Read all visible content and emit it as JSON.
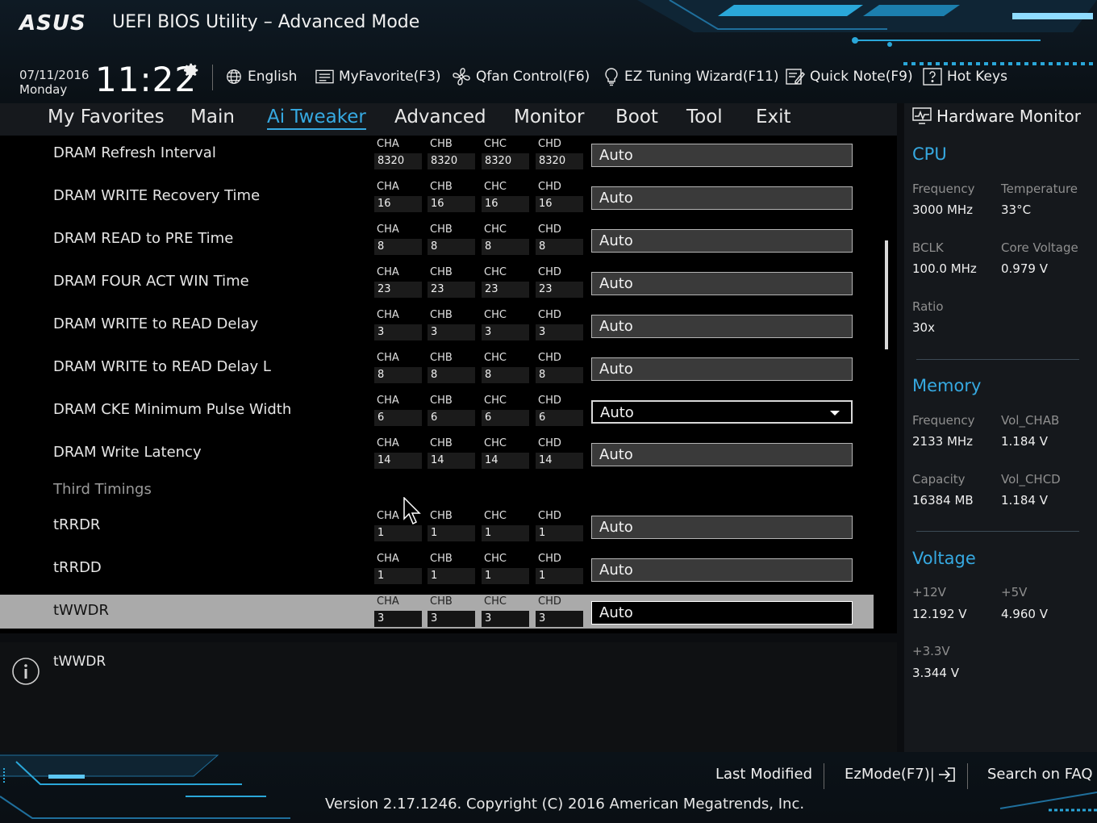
{
  "header": {
    "logo": "ASUS",
    "title": "UEFI BIOS Utility – Advanced Mode",
    "date": "07/11/2016",
    "day": "Monday",
    "time": "11:22",
    "toolbar": [
      {
        "label": "English",
        "icon": "globe-icon"
      },
      {
        "label": "MyFavorite(F3)",
        "icon": "favorite-list-icon"
      },
      {
        "label": "Qfan Control(F6)",
        "icon": "fan-icon"
      },
      {
        "label": "EZ Tuning Wizard(F11)",
        "icon": "lightbulb-icon"
      },
      {
        "label": "Quick Note(F9)",
        "icon": "note-icon"
      },
      {
        "label": "Hot Keys",
        "icon": "help-key-icon"
      }
    ]
  },
  "nav": {
    "tabs": [
      "My Favorites",
      "Main",
      "Ai Tweaker",
      "Advanced",
      "Monitor",
      "Boot",
      "Tool",
      "Exit"
    ],
    "active": "Ai Tweaker"
  },
  "channel_headers": [
    "CHA",
    "CHB",
    "CHC",
    "CHD"
  ],
  "settings": [
    {
      "label": "DRAM Refresh Interval",
      "values": [
        "8320",
        "8320",
        "8320",
        "8320"
      ],
      "value": "Auto"
    },
    {
      "label": "DRAM WRITE Recovery Time",
      "values": [
        "16",
        "16",
        "16",
        "16"
      ],
      "value": "Auto"
    },
    {
      "label": "DRAM READ to PRE Time",
      "values": [
        "8",
        "8",
        "8",
        "8"
      ],
      "value": "Auto"
    },
    {
      "label": "DRAM FOUR ACT WIN Time",
      "values": [
        "23",
        "23",
        "23",
        "23"
      ],
      "value": "Auto"
    },
    {
      "label": "DRAM WRITE to READ Delay",
      "values": [
        "3",
        "3",
        "3",
        "3"
      ],
      "value": "Auto"
    },
    {
      "label": "DRAM WRITE to READ Delay L",
      "values": [
        "8",
        "8",
        "8",
        "8"
      ],
      "value": "Auto"
    },
    {
      "label": "DRAM CKE Minimum Pulse Width",
      "values": [
        "6",
        "6",
        "6",
        "6"
      ],
      "value": "Auto"
    },
    {
      "label": "DRAM Write Latency",
      "values": [
        "14",
        "14",
        "14",
        "14"
      ],
      "value": "Auto"
    }
  ],
  "third_timings": {
    "heading": "Third Timings",
    "items": [
      {
        "label": "tRRDR",
        "values": [
          "1",
          "1",
          "1",
          "1"
        ],
        "value": "Auto"
      },
      {
        "label": "tRRDD",
        "values": [
          "1",
          "1",
          "1",
          "1"
        ],
        "value": "Auto"
      },
      {
        "label": "tWWDR",
        "values": [
          "3",
          "3",
          "3",
          "3"
        ],
        "value": "Auto"
      }
    ]
  },
  "help": {
    "title": "tWWDR"
  },
  "hardware_monitor": {
    "title": "Hardware Monitor",
    "cpu": {
      "heading": "CPU",
      "frequency_label": "Frequency",
      "frequency": "3000 MHz",
      "temperature_label": "Temperature",
      "temperature": "33°C",
      "bclk_label": "BCLK",
      "bclk": "100.0 MHz",
      "core_voltage_label": "Core Voltage",
      "core_voltage": "0.979 V",
      "ratio_label": "Ratio",
      "ratio": "30x"
    },
    "memory": {
      "heading": "Memory",
      "frequency_label": "Frequency",
      "frequency": "2133 MHz",
      "vol_chab_label": "Vol_CHAB",
      "vol_chab": "1.184 V",
      "capacity_label": "Capacity",
      "capacity": "16384 MB",
      "vol_chcd_label": "Vol_CHCD",
      "vol_chcd": "1.184 V"
    },
    "voltage": {
      "heading": "Voltage",
      "v12_label": "+12V",
      "v12": "12.192 V",
      "v5_label": "+5V",
      "v5": "4.960 V",
      "v33_label": "+3.3V",
      "v33": "3.344 V"
    }
  },
  "footer": {
    "last_modified": "Last Modified",
    "ezmode": "EzMode(F7)|",
    "search_faq": "Search on FAQ",
    "copyright": "Version 2.17.1246. Copyright (C) 2016 American Megatrends, Inc."
  },
  "colors": {
    "accent": "#36a9e1",
    "selected_row": "#aaaaaa",
    "background": "#000000"
  }
}
